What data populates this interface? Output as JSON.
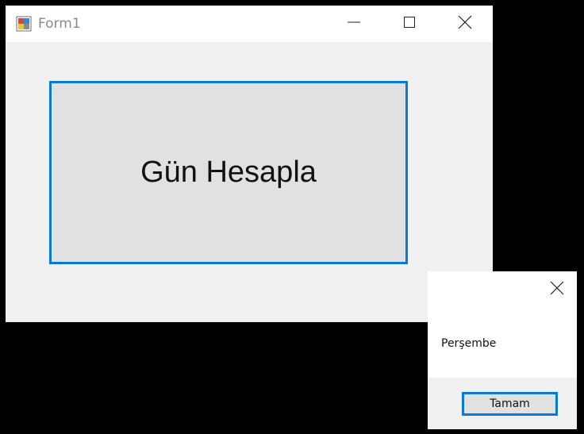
{
  "form": {
    "title": "Form1",
    "icon": "windows-form-icon",
    "controls": {
      "minimize": "minimize-icon",
      "maximize": "maximize-icon",
      "close": "close-icon"
    },
    "main_button_label": "Gün Hesapla"
  },
  "message_box": {
    "text": "Perşembe",
    "ok_label": "Tamam",
    "close_icon": "close-icon"
  },
  "colors": {
    "accent_border": "#0a78d7",
    "button_face": "#e1e1e1",
    "window_bg": "#f0f0f0",
    "title_text": "#8a8a8a"
  }
}
